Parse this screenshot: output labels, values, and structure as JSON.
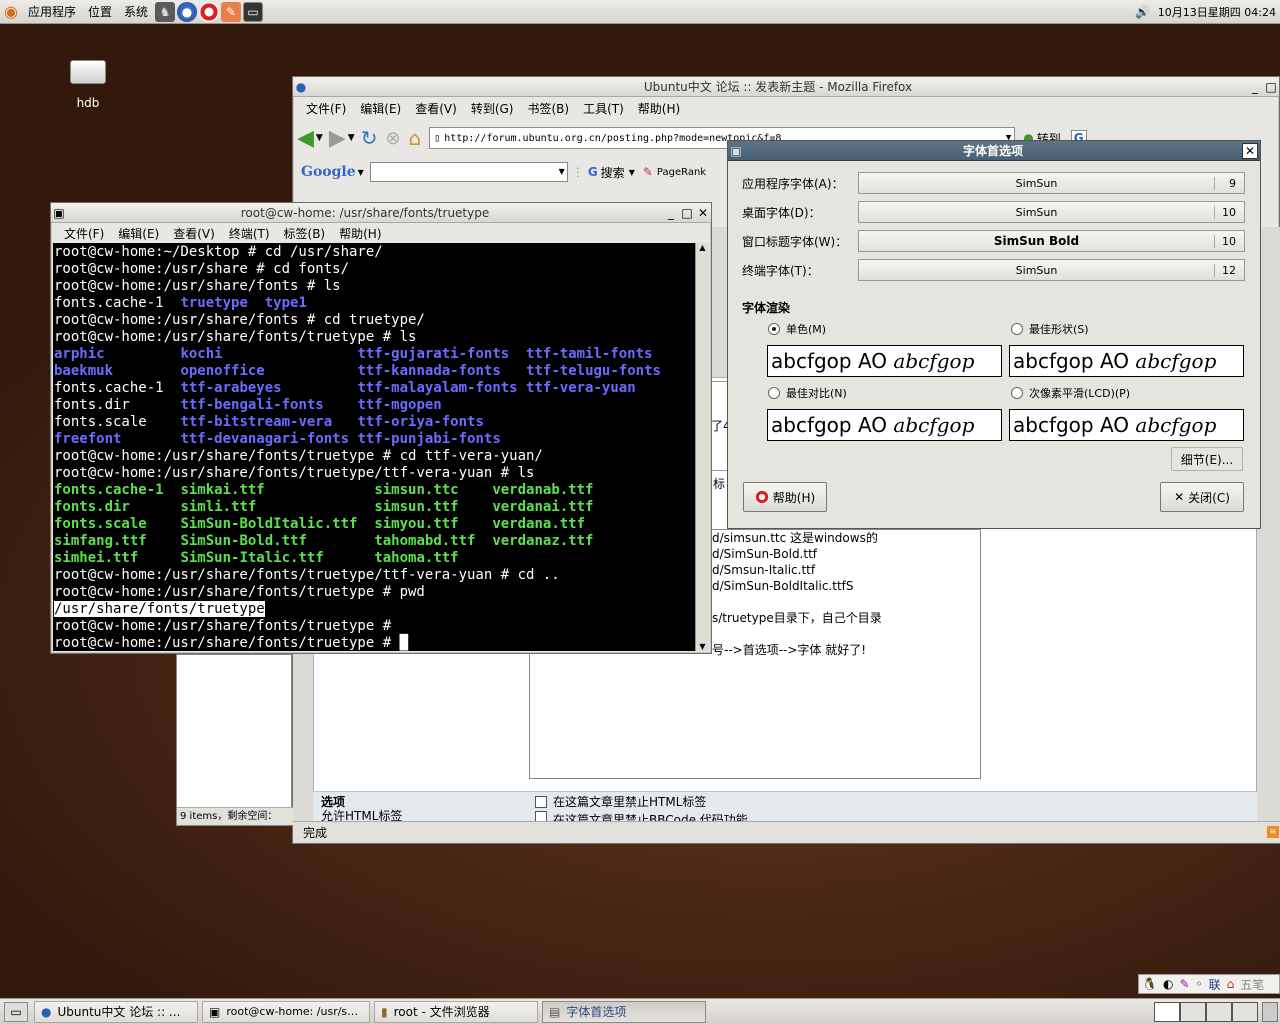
{
  "top_panel": {
    "menus": [
      "应用程序",
      "位置",
      "系统"
    ],
    "clock": "10月13日星期四 04:24"
  },
  "desktop": {
    "icon_label": "hdb"
  },
  "firefox": {
    "title": "Ubuntu中文 论坛 :: 发表新主题 - Mozilla Firefox",
    "menus": [
      "文件(F)",
      "编辑(E)",
      "查看(V)",
      "转到(G)",
      "书签(B)",
      "工具(T)",
      "帮助(H)"
    ],
    "url": "http://forum.ubuntu.org.cn/posting.php?mode=newtopic&f=8",
    "go_label": "转到",
    "google_label": "Google",
    "search_label": "搜索",
    "pagerank_label": "PageRank",
    "post_lines": [
      "d/simsun.ttc  这是windows的",
      "d/SimSun-Bold.ttf",
      "d/Smsun-Italic.ttf",
      "d/SimSun-BoldItalic.ttfS",
      "",
      "s/truetype目录下，自己个目录",
      "",
      "号-->首选项-->字体 就好了!"
    ],
    "options_title": "选项",
    "options_sub": "允许HTML标签",
    "checkbox1": "在这篇文章里禁止HTML标签",
    "checkbox2": "在这篇文章里禁止BBCode 代码功能",
    "left_status": "9 items，剩余空间：",
    "status": "完成",
    "fragment_1": "了4",
    "fragment_2": "标"
  },
  "terminal": {
    "title": "root@cw-home: /usr/share/fonts/truetype",
    "menus": [
      "文件(F)",
      "编辑(E)",
      "查看(V)",
      "终端(T)",
      "标签(B)",
      "帮助(H)"
    ],
    "lines": [
      [
        [
          "root@cw-home:~/Desktop # cd /usr/share/",
          ""
        ]
      ],
      [
        [
          "root@cw-home:/usr/share # cd fonts/",
          ""
        ]
      ],
      [
        [
          "root@cw-home:/usr/share/fonts # ls",
          ""
        ]
      ],
      [
        [
          "fonts.cache-1  ",
          ""
        ],
        [
          "truetype",
          "blue"
        ],
        [
          "  ",
          ""
        ],
        [
          "type1",
          "blue"
        ]
      ],
      [
        [
          "root@cw-home:/usr/share/fonts # cd truetype/",
          ""
        ]
      ],
      [
        [
          "root@cw-home:/usr/share/fonts/truetype # ls",
          ""
        ]
      ],
      [
        [
          "arphic",
          "blue"
        ],
        [
          "         ",
          ""
        ],
        [
          "kochi",
          "blue"
        ],
        [
          "                ",
          ""
        ],
        [
          "ttf-gujarati-fonts",
          "blue"
        ],
        [
          "  ",
          ""
        ],
        [
          "ttf-tamil-fonts",
          "blue"
        ]
      ],
      [
        [
          "baekmuk",
          "blue"
        ],
        [
          "        ",
          ""
        ],
        [
          "openoffice",
          "blue"
        ],
        [
          "           ",
          ""
        ],
        [
          "ttf-kannada-fonts",
          "blue"
        ],
        [
          "   ",
          ""
        ],
        [
          "ttf-telugu-fonts",
          "blue"
        ]
      ],
      [
        [
          "fonts.cache-1  ",
          ""
        ],
        [
          "ttf-arabeyes",
          "blue"
        ],
        [
          "         ",
          ""
        ],
        [
          "ttf-malayalam-fonts",
          "blue"
        ],
        [
          " ",
          ""
        ],
        [
          "ttf-vera-yuan",
          "blue"
        ]
      ],
      [
        [
          "fonts.dir      ",
          ""
        ],
        [
          "ttf-bengali-fonts",
          "blue"
        ],
        [
          "    ",
          ""
        ],
        [
          "ttf-mgopen",
          "blue"
        ]
      ],
      [
        [
          "fonts.scale    ",
          ""
        ],
        [
          "ttf-bitstream-vera",
          "blue"
        ],
        [
          "   ",
          ""
        ],
        [
          "ttf-oriya-fonts",
          "blue"
        ]
      ],
      [
        [
          "freefont",
          "blue"
        ],
        [
          "       ",
          ""
        ],
        [
          "ttf-devanagari-fonts",
          "blue"
        ],
        [
          " ",
          ""
        ],
        [
          "ttf-punjabi-fonts",
          "blue"
        ]
      ],
      [
        [
          "root@cw-home:/usr/share/fonts/truetype # cd ttf-vera-yuan/",
          ""
        ]
      ],
      [
        [
          "root@cw-home:/usr/share/fonts/truetype/ttf-vera-yuan # ls",
          ""
        ]
      ],
      [
        [
          "fonts.cache-1",
          "green"
        ],
        [
          "  ",
          ""
        ],
        [
          "simkai.ttf",
          "green"
        ],
        [
          "             ",
          ""
        ],
        [
          "simsun.ttc",
          "green"
        ],
        [
          "    ",
          ""
        ],
        [
          "verdanab.ttf",
          "green"
        ]
      ],
      [
        [
          "fonts.dir",
          "green"
        ],
        [
          "      ",
          ""
        ],
        [
          "simli.ttf",
          "green"
        ],
        [
          "              ",
          ""
        ],
        [
          "simsun.ttf",
          "green"
        ],
        [
          "    ",
          ""
        ],
        [
          "verdanai.ttf",
          "green"
        ]
      ],
      [
        [
          "fonts.scale",
          "green"
        ],
        [
          "    ",
          ""
        ],
        [
          "SimSun-BoldItalic.ttf",
          "green"
        ],
        [
          "  ",
          ""
        ],
        [
          "simyou.ttf",
          "green"
        ],
        [
          "    ",
          ""
        ],
        [
          "verdana.ttf",
          "green"
        ]
      ],
      [
        [
          "simfang.ttf",
          "green"
        ],
        [
          "    ",
          ""
        ],
        [
          "SimSun-Bold.ttf",
          "green"
        ],
        [
          "        ",
          ""
        ],
        [
          "tahomabd.ttf",
          "green"
        ],
        [
          "  ",
          ""
        ],
        [
          "verdanaz.ttf",
          "green"
        ]
      ],
      [
        [
          "simhei.ttf",
          "green"
        ],
        [
          "     ",
          ""
        ],
        [
          "SimSun-Italic.ttf",
          "green"
        ],
        [
          "      ",
          ""
        ],
        [
          "tahoma.ttf",
          "green"
        ]
      ],
      [
        [
          "root@cw-home:/usr/share/fonts/truetype/ttf-vera-yuan # cd ..",
          ""
        ]
      ],
      [
        [
          "root@cw-home:/usr/share/fonts/truetype # pwd",
          ""
        ]
      ],
      [
        [
          "/usr/share/fonts/truetype",
          "hl"
        ]
      ],
      [
        [
          "root@cw-home:/usr/share/fonts/truetype #",
          ""
        ]
      ],
      [
        [
          "root@cw-home:/usr/share/fonts/truetype # ",
          ""
        ],
        [
          "█",
          "cursor"
        ]
      ]
    ]
  },
  "font_prefs": {
    "title": "字体首选项",
    "rows": [
      {
        "label": "应用程序字体(A)：",
        "font": "SimSun",
        "size": "9"
      },
      {
        "label": "桌面字体(D)：",
        "font": "SimSun",
        "size": "10"
      },
      {
        "label": "窗口标题字体(W)：",
        "font": "SimSun Bold",
        "size": "10"
      },
      {
        "label": "终端字体(T)：",
        "font": "SimSun",
        "size": "12"
      }
    ],
    "render_title": "字体渲染",
    "options": [
      "单色(M)",
      "最佳形状(S)",
      "最佳对比(N)",
      "次像素平滑(LCD)(P)"
    ],
    "selected_option": "单色(M)",
    "sample_text": "abcfgop AO ",
    "sample_italic": "abcfgop",
    "details_label": "细节(E)...",
    "help_label": "帮助(H)",
    "close_label": "关闭(C)"
  },
  "bottom_panel": {
    "tasks": [
      "Ubuntu中文 论坛 :: ...",
      "root@cw-home: /usr/s…",
      "root - 文件浏览器",
      "字体首选项"
    ]
  },
  "ime": {
    "label_1": "联",
    "label_2": "五笔"
  }
}
